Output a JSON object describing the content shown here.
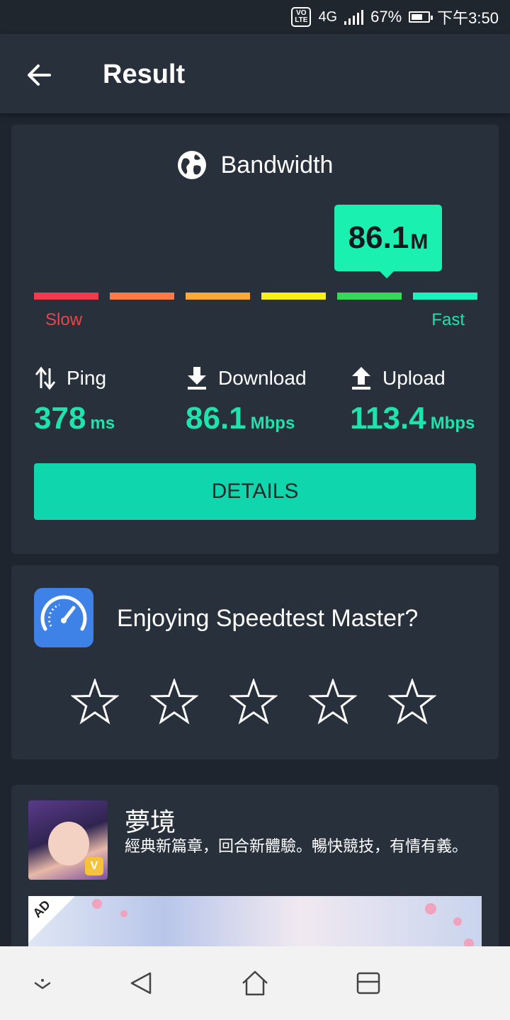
{
  "status_bar": {
    "volte": "VoLTE",
    "network": "4G",
    "battery": "67%",
    "battery_level": 0.67,
    "time": "下午3:50"
  },
  "app_bar": {
    "title": "Result",
    "back_icon": "arrow-left-icon"
  },
  "bandwidth": {
    "title": "Bandwidth",
    "icon": "globe-icon",
    "value": "86.1",
    "unit": "M",
    "scale_level": 0.86,
    "scale_colors": [
      "#ef3b4b",
      "#f97b45",
      "#f9a93c",
      "#f7f01c",
      "#37d85a",
      "#1cf2bd"
    ],
    "slow_label": "Slow",
    "fast_label": "Fast",
    "slow_color": "#ee4449",
    "fast_color": "#1fe3ad"
  },
  "metrics": {
    "ping": {
      "label": "Ping",
      "value": "378",
      "unit": "ms",
      "icon": "up-down-arrows-icon"
    },
    "download": {
      "label": "Download",
      "value": "86.1",
      "unit": "Mbps",
      "icon": "download-icon"
    },
    "upload": {
      "label": "Upload",
      "value": "113.4",
      "unit": "Mbps",
      "icon": "upload-icon"
    }
  },
  "details_button": "DETAILS",
  "rating": {
    "question": "Enjoying Speedtest Master?",
    "stars": 5,
    "icon": "speedometer-icon"
  },
  "ad": {
    "title": "夢境",
    "description": "經典新篇章，回合新體驗。暢快競技，有情有義。",
    "ad_label": "AD",
    "badge_text": "V"
  },
  "navigation": [
    "expand-icon",
    "back-triangle-icon",
    "home-icon",
    "recents-icon"
  ]
}
